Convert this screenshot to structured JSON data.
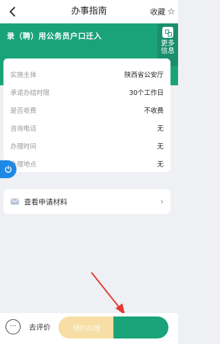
{
  "header": {
    "back_icon": "chevron-left-icon",
    "title": "办事指南",
    "favorite_label": "收藏",
    "favorite_icon": "☆"
  },
  "banner": {
    "title": "录（聘）用公务员户口迁入",
    "more_label": "更多信息",
    "color": "#1aa378"
  },
  "info": {
    "rows": [
      {
        "label": "实施主体",
        "value": "陕西省公安厅"
      },
      {
        "label": "承诺办结时限",
        "value": "30个工作日"
      },
      {
        "label": "是否收费",
        "value": "不收费"
      },
      {
        "label": "咨询电话",
        "value": "无"
      },
      {
        "label": "办理时间",
        "value": "无"
      },
      {
        "label": "办理地点",
        "value": "无"
      }
    ]
  },
  "materials": {
    "label": "查看申请材料",
    "icon": "mail-icon"
  },
  "bottom": {
    "chat_icon": "···",
    "review_label": "去评价",
    "reserve_label": "预约办理",
    "apply_label": "",
    "apply_color": "#1aa378",
    "reserve_color": "#f6dea4"
  },
  "annotation": {
    "arrow_color": "#e53935"
  }
}
